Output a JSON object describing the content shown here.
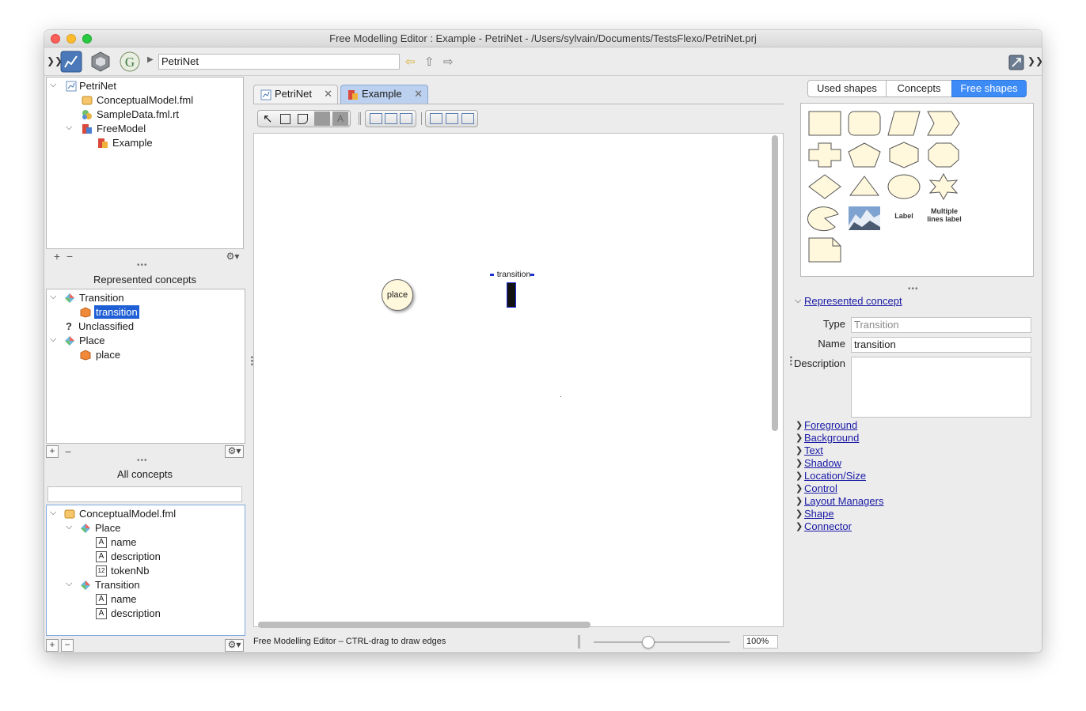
{
  "window": {
    "title": "Free Modelling Editor : Example - PetriNet - /Users/sylvain/Documents/TestsFlexo/PetriNet.prj"
  },
  "toolbar": {
    "path": "PetriNet"
  },
  "project_tree": {
    "items": [
      "PetriNet",
      "ConceptualModel.fml",
      "SampleData.fml.rt",
      "FreeModel",
      "Example"
    ]
  },
  "represented_concepts": {
    "title": "Represented concepts",
    "items": [
      "Transition",
      "transition",
      "Unclassified",
      "Place",
      "place"
    ]
  },
  "all_concepts": {
    "title": "All concepts",
    "search_value": "",
    "items": [
      "ConceptualModel.fml",
      "Place",
      "name",
      "description",
      "tokenNb",
      "Transition",
      "name",
      "description"
    ]
  },
  "editor": {
    "tabs": [
      {
        "label": "PetriNet"
      },
      {
        "label": "Example"
      }
    ],
    "active_tab": "Example",
    "canvas": {
      "place_label": "place",
      "transition_label": "transition"
    },
    "status": "Free Modelling Editor – CTRL-drag to draw edges",
    "zoom": "100%",
    "zoom_level": 0.4
  },
  "right_panel": {
    "tabs": [
      "Used shapes",
      "Concepts",
      "Free shapes"
    ],
    "selected_tab": "Free shapes",
    "palette_labels": {
      "label": "Label",
      "multi": "Multiple lines label"
    },
    "represented_concept": {
      "header": "Represented concept",
      "type_label": "Type",
      "type_value": "Transition",
      "name_label": "Name",
      "name_value": "transition",
      "description_label": "Description",
      "description_value": ""
    },
    "sections": [
      "Foreground",
      "Background",
      "Text",
      "Shadow",
      "Location/Size",
      "Control",
      "Layout Managers",
      "Shape",
      "Connector"
    ]
  },
  "colors": {
    "selection": "#1f5fd6",
    "shape_fill": "#fff8dc",
    "active_tab": "#bcd0ef",
    "segment_selected": "#3d8bf7"
  }
}
